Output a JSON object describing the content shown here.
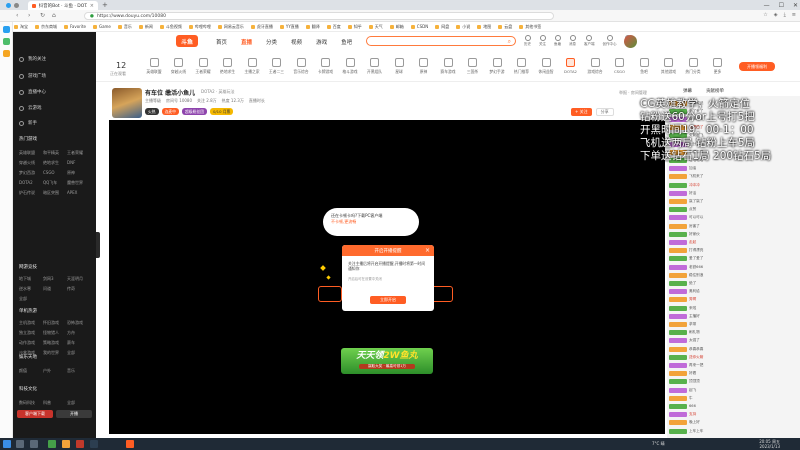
{
  "browser": {
    "tabs": [
      {
        "label": "抖音的Bot · 斗鱼 · DOTA2直播..."
      },
      {
        "label": "斗鱼 - 每个人的直播平台"
      }
    ],
    "url": "https://www.douyu.com/10080",
    "bookmarks": [
      "淘宝",
      "京东商城",
      "Favorite",
      "Game",
      "音乐",
      "新闻",
      "斗鱼视频",
      "哔哩哔哩",
      "网易云音乐",
      "虎牙直播",
      "YY直播",
      "翻译",
      "百度",
      "知乎",
      "天气",
      "邮箱",
      "CSDN",
      "网盘",
      "小说",
      "地图",
      "云盘",
      "其他书签"
    ]
  },
  "leftnav": {
    "top_items": [
      "我的关注",
      "游戏广场",
      "直播中心",
      "云游戏"
    ],
    "newbie_label": "新手",
    "sections": [
      {
        "title": "热门游戏",
        "items": [
          "英雄联盟",
          "和平精英",
          "王者荣耀",
          "穿越火线",
          "绝地求生",
          "DNF",
          "梦幻西游",
          "CSGO",
          "原神",
          "DOTA2",
          "QQ飞车",
          "魔兽世界",
          "炉石传说",
          "暗区突围",
          "APEX"
        ]
      },
      {
        "title": "网游竞技",
        "items": [
          "地下城",
          "剑网3",
          "天涯明月",
          "逆水寒",
          "问道",
          "传奇",
          "全部"
        ]
      },
      {
        "title": "单机热游",
        "items": [
          "主机游戏",
          "怀旧游戏",
          "恐怖游戏",
          "独立游戏",
          "怪物猎人",
          "方舟",
          "动作游戏",
          "策略游戏",
          "赛车",
          "沙盒游戏",
          "我的世界",
          "全部"
        ]
      },
      {
        "title": "娱乐天地",
        "items": [
          "颜值",
          "户外",
          "音乐"
        ]
      },
      {
        "title": "科技文化",
        "items": [
          "数码科技",
          "科普",
          "全部"
        ]
      }
    ],
    "bottom_buttons": [
      "客户端下载",
      "开播"
    ]
  },
  "header": {
    "logo": "斗鱼",
    "nav": [
      "首页",
      "直播",
      "分类",
      "视频",
      "游戏",
      "鱼吧"
    ],
    "active_nav": "直播",
    "icons": [
      "历史",
      "关注",
      "鱼塘",
      "消息",
      "客户端",
      "创作中心",
      "我的"
    ]
  },
  "categories": {
    "viewers_number": "12",
    "viewers_label": "正在观看",
    "items": [
      "英雄联盟",
      "穿越火线",
      "王者荣耀",
      "绝地求生",
      "主播之家",
      "王者二三",
      "音乐综合",
      "卡牌游戏",
      "格斗游戏",
      "开黑组队",
      "星球",
      "原神",
      "赛车游戏",
      "三国杀",
      "梦幻手游",
      "热门推荐",
      "休闲益智",
      "DOTA2",
      "游戏综合",
      "CSGO",
      "鱼吧",
      "其他游戏",
      "热门分类",
      "更多"
    ],
    "open_live": "开播领福利"
  },
  "room": {
    "title": "有车位 缴活小鱼儿",
    "category": "DOTA2 · 英雄玩法",
    "meta": [
      "主播等级",
      "房间号 10080",
      "关注 2.8万",
      "热度 12.3万",
      "直播时长"
    ],
    "tags": [
      "火热",
      "连麦中",
      "超级粉丝团",
      "0/10 月票"
    ],
    "follow": "+ 关注",
    "share": "分享",
    "report": "举报 · 房间管理"
  },
  "video": {
    "bubble_line1": "还在卡顿卡吗?下载PC客户端",
    "bubble_hl": "不卡顿,更流畅",
    "modal": {
      "title": "开启开播提醒",
      "body": "关注主播后将开启开播提醒,开播时将第一时间通知你",
      "sub": "开启后可在设置中关闭",
      "button": "立即开启"
    },
    "banner_big_white": "天天领",
    "banner_big_yellow": "2W鱼丸",
    "banner_small": "赢取大奖 · 最高可领1万"
  },
  "chat": {
    "tabs": [
      "弹幕",
      "贡献榜单"
    ],
    "messages": [
      "主播威武",
      "来了来了",
      "666666",
      "这把稳了",
      "火箭起飞",
      "上分上分",
      "牛啊牛啊",
      "哈哈哈哈",
      "加油",
      "飞机来了",
      "冲冲冲",
      "好活",
      "赢了赢了",
      "点赞",
      "可以可以",
      "厉害了",
      "好家伙",
      "走起",
      "打得漂亮",
      "爱了爱了",
      "老铁666",
      "稳住别浪",
      "绝了",
      "奥利给",
      "秀啊",
      "来啦",
      "主播好",
      "求带",
      "刷礼物",
      "太强了",
      "恭喜恭喜",
      "送你火箭",
      "再来一把",
      "好看",
      "顶顶顶",
      "起飞",
      "牛",
      "666",
      "支持",
      "晚上好",
      "上车上车"
    ]
  },
  "overlay_lines": [
    "CG英雄教学，火箭定位",
    "钻粉送60分or上号打5把",
    "开黑时间19：00-1：00",
    "飞机送两局 钻粉上车5局",
    "下单送钻石1局 200钻石5局"
  ],
  "taskbar": {
    "weather": "7°C 晴",
    "time": "20:05 周五",
    "date": "2023/1/13"
  }
}
